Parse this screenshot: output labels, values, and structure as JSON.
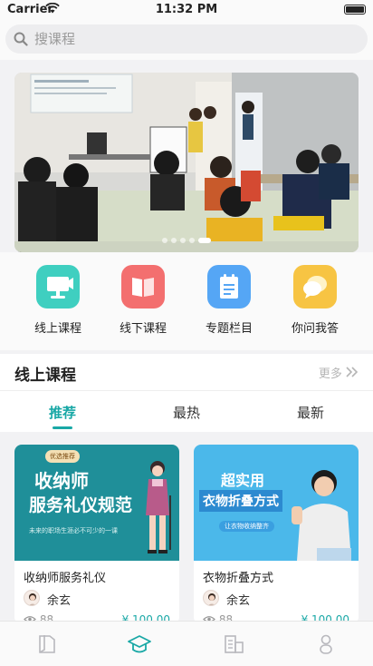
{
  "status_bar": {
    "carrier": "Carrier",
    "time": "11:32 PM",
    "battery_level": 1.0
  },
  "search": {
    "placeholder": "搜课程",
    "value": ""
  },
  "banner": {
    "slide_count": 5,
    "active_index": 4
  },
  "quick_nav": [
    {
      "label": "线上课程",
      "icon": "video-course-icon",
      "color": "#3fcfc0"
    },
    {
      "label": "线下课程",
      "icon": "open-book-icon",
      "color": "#f36f6f"
    },
    {
      "label": "专题栏目",
      "icon": "notepad-icon",
      "color": "#55a6f5"
    },
    {
      "label": "你问我答",
      "icon": "chat-bubbles-icon",
      "color": "#f7c443"
    }
  ],
  "section": {
    "title": "线上课程",
    "more_label": "更多",
    "more_icon": "double-chevron-right-icon",
    "tabs": [
      {
        "label": "推荐",
        "active": true
      },
      {
        "label": "最热",
        "active": false
      },
      {
        "label": "最新",
        "active": false
      }
    ]
  },
  "courses": [
    {
      "title": "收纳师服务礼仪",
      "teacher": "余玄",
      "views": "88",
      "price": "¥ 100.00",
      "thumb": {
        "bg": "#1f8f99",
        "badge": "优选推荐",
        "line1": "收纳师",
        "line2": "服务礼仪规范",
        "sub": "未来的职场生涯必不可少的一课"
      }
    },
    {
      "title": "衣物折叠方式",
      "teacher": "余玄",
      "views": "88",
      "price": "¥ 100.00",
      "thumb": {
        "bg": "#4bb8ea",
        "line1": "超实用",
        "line2": "衣物折叠方式",
        "sub": "让衣物收纳整齐"
      }
    }
  ],
  "tabbar": [
    {
      "icon": "book-icon",
      "active": false
    },
    {
      "icon": "graduation-cap-icon",
      "active": true
    },
    {
      "icon": "buildings-icon",
      "active": false
    },
    {
      "icon": "user-icon",
      "active": false
    }
  ],
  "colors": {
    "accent": "#19a8a6",
    "inactive_icon": "#b8b8bd"
  }
}
